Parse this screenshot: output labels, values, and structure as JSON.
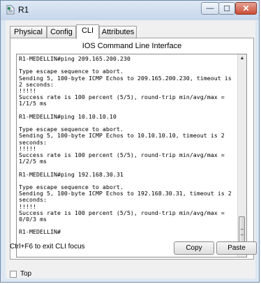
{
  "window": {
    "title": "R1",
    "minimize_glyph": "—",
    "maximize_glyph": "☐",
    "close_glyph": "✕"
  },
  "tabs": [
    {
      "label": "Physical"
    },
    {
      "label": "Config"
    },
    {
      "label": "CLI",
      "active": true
    },
    {
      "label": "Attributes"
    }
  ],
  "cli": {
    "header": "IOS Command Line Interface",
    "text": "R1-MEDELLIN#ping 209.165.200.230\n\nType escape sequence to abort.\nSending 5, 100-byte ICMP Echos to 209.165.200.230, timeout is 2 seconds:\n!!!!!\nSuccess rate is 100 percent (5/5), round-trip min/avg/max = 1/1/5 ms\n\nR1-MEDELLIN#ping 10.10.10.10\n\nType escape sequence to abort.\nSending 5, 100-byte ICMP Echos to 10.10.10.10, timeout is 2 seconds:\n!!!!!\nSuccess rate is 100 percent (5/5), round-trip min/avg/max = 1/2/5 ms\n\nR1-MEDELLIN#ping 192.168.30.31\n\nType escape sequence to abort.\nSending 5, 100-byte ICMP Echos to 192.168.30.31, timeout is 2 seconds:\n!!!!!\nSuccess rate is 100 percent (5/5), round-trip min/avg/max = 0/0/3 ms\n\nR1-MEDELLIN#",
    "focus_hint": "Ctrl+F6 to exit CLI focus",
    "copy_label": "Copy",
    "paste_label": "Paste",
    "scroll_up_glyph": "▲",
    "scroll_down_glyph": "▼"
  },
  "bottom": {
    "top_label": "Top",
    "top_checked": false
  },
  "colors": {
    "title_bar": "#c6d6ea",
    "close_button": "#c94d35",
    "panel_background": "#f0f0f0"
  }
}
